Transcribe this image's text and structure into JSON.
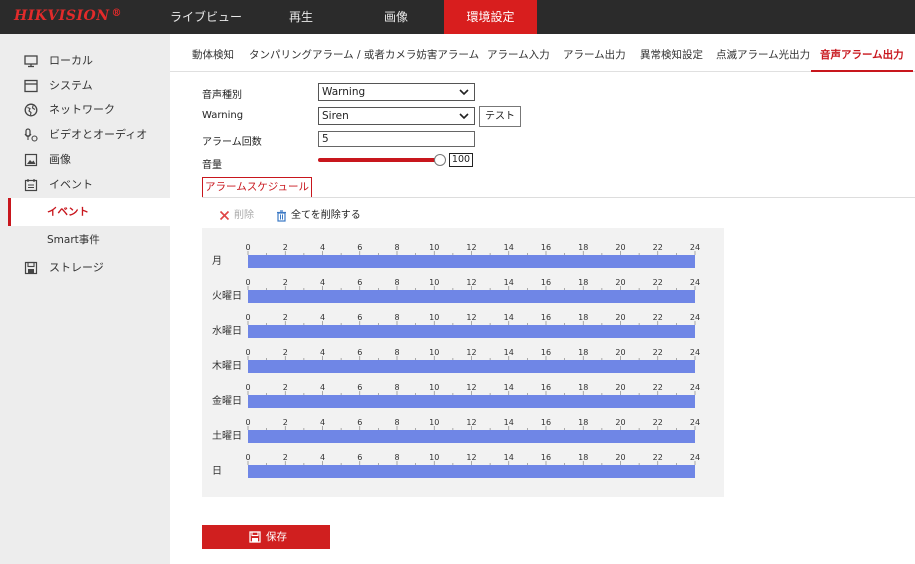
{
  "brand": {
    "logo": "HIKVISION",
    "reg": "®",
    "logo_color": "#e22b2b"
  },
  "topnav": [
    {
      "label": "ライブビュー"
    },
    {
      "label": "再生"
    },
    {
      "label": "画像"
    },
    {
      "label": "環境設定",
      "active": true
    }
  ],
  "sidebar": {
    "items": [
      {
        "label": "ローカル",
        "icon": "monitor-icon"
      },
      {
        "label": "システム",
        "icon": "system-icon"
      },
      {
        "label": "ネットワーク",
        "icon": "network-icon"
      },
      {
        "label": "ビデオとオーディオ",
        "icon": "video-audio-icon"
      },
      {
        "label": "画像",
        "icon": "image-icon"
      },
      {
        "label": "イベント",
        "icon": "event-icon"
      }
    ],
    "subitems": [
      {
        "label": "イベント",
        "active": true
      },
      {
        "label": "Smart事件"
      }
    ],
    "storage": {
      "label": "ストレージ",
      "icon": "storage-icon"
    }
  },
  "tabs": [
    {
      "label": "動体検知"
    },
    {
      "label": "タンパリングアラーム / 或者カメラ妨害アラーム"
    },
    {
      "label": "アラーム入力"
    },
    {
      "label": "アラーム出力"
    },
    {
      "label": "異常検知設定"
    },
    {
      "label": "点滅アラーム光出力"
    },
    {
      "label": "音声アラーム出力",
      "active": true
    }
  ],
  "form": {
    "sound_type_label": "音声種別",
    "sound_type_value": "Warning",
    "warning_label": "Warning",
    "warning_value": "Siren",
    "test_button": "テスト",
    "alarm_count_label": "アラーム回数",
    "alarm_count_value": "5",
    "volume_label": "音量",
    "volume_value": "100"
  },
  "schedule": {
    "tab_label": "アラームスケジュール",
    "delete_label": "削除",
    "delete_all_label": "全てを削除する",
    "hour_ticks": [
      "0",
      "2",
      "4",
      "6",
      "8",
      "10",
      "12",
      "14",
      "16",
      "18",
      "20",
      "22",
      "24"
    ],
    "days": [
      "月",
      "火曜日",
      "水曜日",
      "木曜日",
      "金曜日",
      "土曜日",
      "日"
    ],
    "bar_color": "#6f86e6",
    "bars": [
      {
        "start": 0,
        "end": 24
      },
      {
        "start": 0,
        "end": 24
      },
      {
        "start": 0,
        "end": 24
      },
      {
        "start": 0,
        "end": 24
      },
      {
        "start": 0,
        "end": 24
      },
      {
        "start": 0,
        "end": 24
      },
      {
        "start": 0,
        "end": 24
      }
    ]
  },
  "save_button": "保存",
  "accent_color": "#c8161d"
}
